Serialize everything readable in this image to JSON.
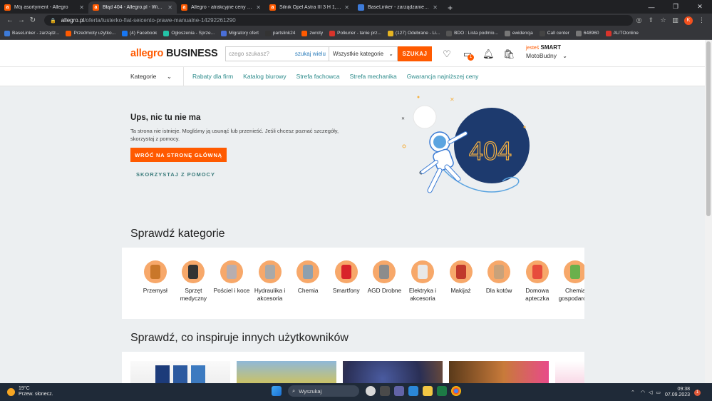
{
  "browser": {
    "tabs": [
      {
        "title": "Mój asortyment - Allegro",
        "favicon": "allegro",
        "active": false
      },
      {
        "title": "Błąd 404 - Allegro.pl - Więcej niż...",
        "favicon": "allegro",
        "active": true
      },
      {
        "title": "Allegro - atrakcyjne ceny - Strona...",
        "favicon": "allegro",
        "active": false
      },
      {
        "title": "Silnik Opel Astra III 3 H 1,6 Twinp...",
        "favicon": "allegro",
        "active": false
      },
      {
        "title": "BaseLinker - zarządzanie sprzedażą",
        "favicon": "baselinker",
        "active": false
      }
    ],
    "url_host": "allegro.pl",
    "url_path": "/oferta/lusterko-fiat-seicento-prawe-manualne-14292261290",
    "profile_initial": "K",
    "bookmarks": [
      {
        "label": "BaseLinker - zarządz...",
        "color": "#3d7bd9"
      },
      {
        "label": "Przedmioty użytko...",
        "color": "#ff5a00"
      },
      {
        "label": "(4) Facebook",
        "color": "#1877f2"
      },
      {
        "label": "Ogłoszenia - Sprze...",
        "color": "#23c3a7"
      },
      {
        "label": "Migratory ofert",
        "color": "#4a6fd8"
      },
      {
        "label": "partslink24",
        "color": "#333333"
      },
      {
        "label": "zwroty",
        "color": "#ff5a00"
      },
      {
        "label": "Polkurier - tanie prz...",
        "color": "#d9342b"
      },
      {
        "label": "(127) Odebrane - Li...",
        "color": "#e6b422"
      },
      {
        "label": "BDO : Lista podmio...",
        "color": "#555555"
      },
      {
        "label": "ewidencja",
        "color": "#777777"
      },
      {
        "label": "Call center",
        "color": "#444444"
      },
      {
        "label": "648960",
        "color": "#777777"
      },
      {
        "label": "AUTOonline",
        "color": "#d9342b"
      }
    ]
  },
  "header": {
    "logo_allegro": "allegro",
    "logo_business": "BUSINESS",
    "search_placeholder": "czego szukasz?",
    "search_hint": "szukaj wielu",
    "category_select": "Wszystkie kategorie",
    "search_button": "SZUKAJ",
    "messages_badge": "1",
    "account_prefix": "jesteś",
    "account_smart": "SMART",
    "account_name": "MotoBudny"
  },
  "subnav": {
    "categories": "Kategorie",
    "links": [
      "Rabaty dla firm",
      "Katalog biurowy",
      "Strefa fachowca",
      "Strefa mechanika",
      "Gwarancja najniższej ceny"
    ]
  },
  "error": {
    "title": "Ups, nic tu nie ma",
    "description": "Ta strona nie istnieje. Mogliśmy ją usunąć lub przenieść. Jeśli chcesz poznać szczegóły, skorzystaj z pomocy.",
    "home_button": "WRÓĆ NA STRONĘ GŁÓWNĄ",
    "help_link": "SKORZYSTAJ Z POMOCY",
    "illustration_text": "404"
  },
  "categories_section": {
    "title": "Sprawdź kategorie",
    "items": [
      {
        "label": "Przemysł",
        "color": "#c9772a"
      },
      {
        "label": "Sprzęt medyczny",
        "color": "#333333"
      },
      {
        "label": "Pościel i koce",
        "color": "#b7aeb0"
      },
      {
        "label": "Hydraulika i akcesoria",
        "color": "#a9a9a9"
      },
      {
        "label": "Chemia",
        "color": "#8fa0ae"
      },
      {
        "label": "Smartfony",
        "color": "#d8232a"
      },
      {
        "label": "AGD Drobne",
        "color": "#8c8c8c"
      },
      {
        "label": "Elektryka i akcesoria",
        "color": "#e8e8e8"
      },
      {
        "label": "Makijaż",
        "color": "#c0392b"
      },
      {
        "label": "Dla kotów",
        "color": "#c9a27a"
      },
      {
        "label": "Domowa apteczka",
        "color": "#e74c3c"
      },
      {
        "label": "Chemia gospodarcza",
        "color": "#6ab04c"
      }
    ]
  },
  "inspire_section": {
    "title": "Sprawdź, co inspiruje innych użytkowników"
  },
  "taskbar": {
    "temp": "19°C",
    "weather": "Przew. słonecz.",
    "search": "Wyszukaj",
    "time": "09:38",
    "date": "07.09.2023",
    "notifications": "1"
  }
}
